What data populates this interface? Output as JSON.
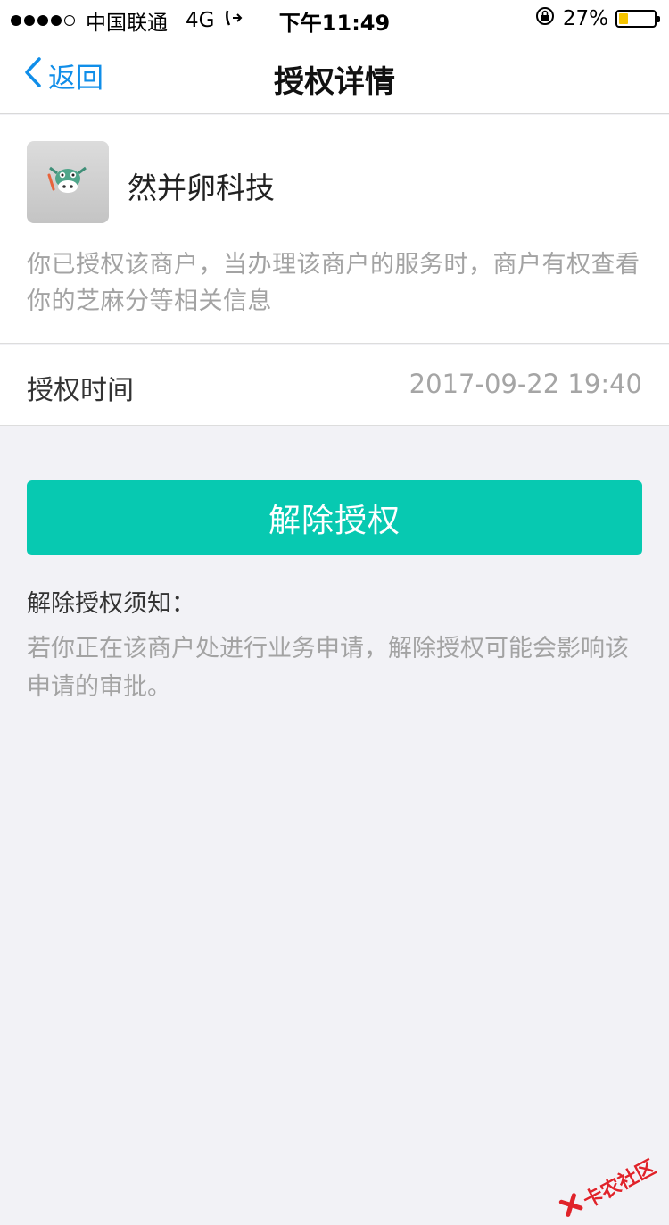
{
  "status_bar": {
    "carrier": "中国联通",
    "network": "4G",
    "time": "下午11:49",
    "battery_percent": "27%",
    "battery_level": 0.27,
    "battery_color": "#f5c400"
  },
  "nav": {
    "back_label": "返回",
    "title": "授权详情"
  },
  "merchant": {
    "name": "然并卵科技",
    "logo_icon": "cow-icon",
    "description": "你已授权该商户，当办理该商户的服务时，商户有权查看你的芝麻分等相关信息"
  },
  "auth_time": {
    "label": "授权时间",
    "value": "2017-09-22 19:40"
  },
  "revoke_button": {
    "label": "解除授权",
    "color": "#07c9b1"
  },
  "notice": {
    "title": "解除授权须知：",
    "text": "若你正在该商户处进行业务申请，解除授权可能会影响该申请的审批。"
  },
  "watermark": {
    "text": "卡农社区"
  },
  "colors": {
    "accent_blue": "#108ee9",
    "background": "#f2f2f6"
  }
}
